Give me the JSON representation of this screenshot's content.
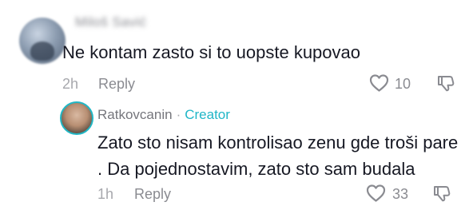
{
  "comments": [
    {
      "author": "Miloš Savić",
      "text": "Ne kontam zasto si to uopste kupovao",
      "time": "2h",
      "reply_label": "Reply",
      "likes": "10"
    }
  ],
  "reply": {
    "author": "Ratkovcanin",
    "separator": "·",
    "badge": "Creator",
    "text_line1": "Zato sto nisam kontrolisao zenu gde troši pare",
    "text_line2": ". Da pojednostavim, zato sto sam budala",
    "time": "1h",
    "reply_label": "Reply",
    "likes": "33"
  },
  "colors": {
    "creator_accent": "#20b6c7",
    "meta_gray": "#8a8b91",
    "text_dark": "#161823"
  },
  "icons": [
    "heart-outline-icon",
    "dislike-icon",
    "avatar"
  ]
}
